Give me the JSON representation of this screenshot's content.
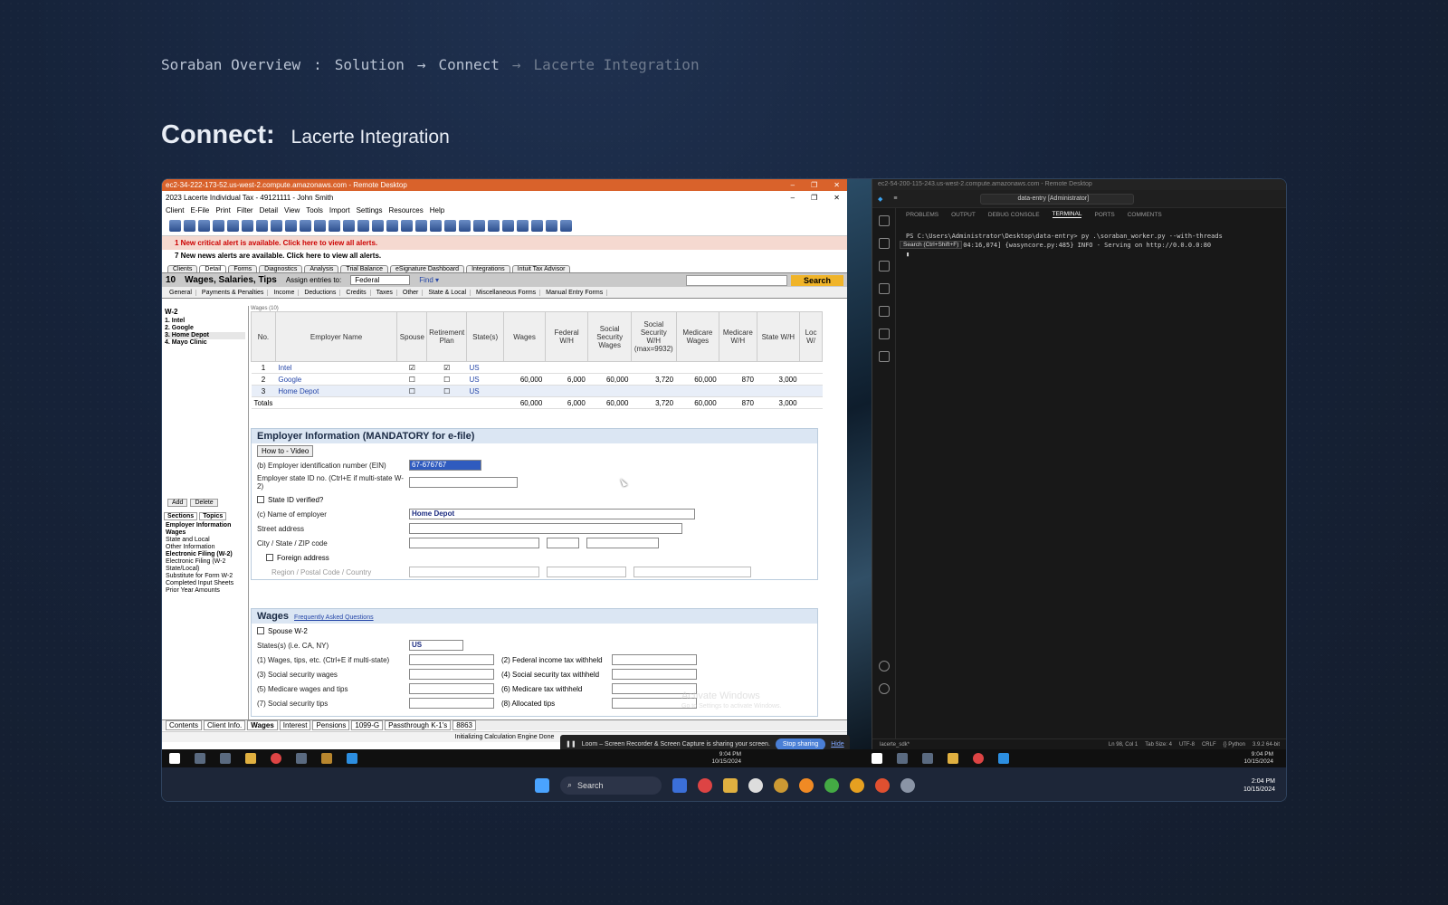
{
  "breadcrumb": {
    "items": [
      "Soraban Overview",
      ":",
      "Solution",
      "→",
      "Connect",
      "→",
      "Lacerte Integration"
    ]
  },
  "heading": {
    "main": "Connect:",
    "sub": "Lacerte Integration"
  },
  "left_window": {
    "rd_title": "ec2-34-222-173-52.us-west-2.compute.amazonaws.com - Remote Desktop",
    "app_title": "2023 Lacerte Individual Tax - 49121111 - John Smith",
    "menu": [
      "Client",
      "E-File",
      "Print",
      "Filter",
      "Detail",
      "View",
      "Tools",
      "Import",
      "Settings",
      "Resources",
      "Help"
    ],
    "alert": "1  New critical alert is available.  Click here to view all alerts.",
    "news": "7  New news alerts are available.  Click here to view all alerts.",
    "tabs": [
      "Clients",
      "Detail",
      "Forms",
      "Diagnostics",
      "Analysis",
      "Trial Balance",
      "eSignature Dashboard",
      "Integrations",
      "Intuit Tax Advisor"
    ],
    "section": {
      "num": "10",
      "name": "Wages, Salaries, Tips",
      "assign_label": "Assign entries to:",
      "assign_value": "Federal",
      "find": "Find ▾",
      "search_btn": "Search"
    },
    "sub_tabs": [
      "General",
      "Payments & Penalties",
      "Income",
      "Deductions",
      "Credits",
      "Taxes",
      "Other",
      "State & Local",
      "Miscellaneous Forms",
      "Manual Entry Forms"
    ],
    "sidebar": {
      "header": "W-2",
      "items": [
        "1. Intel",
        "2. Google",
        "3. Home Depot",
        "4. Mayo Clinic"
      ],
      "add": "Add",
      "delete": "Delete",
      "tabs": [
        "Sections",
        "Topics"
      ],
      "sections": [
        "Employer Information",
        "Wages",
        "State and Local",
        "Other Information",
        "Electronic Filing (W-2)",
        "Electronic Filing (W-2 State/Local)",
        "Substitute for Form W-2",
        "Completed Input Sheets",
        "Prior Year Amounts"
      ]
    },
    "grid": {
      "caption": "Wages (10)",
      "headers": [
        "No.",
        "Employer Name",
        "Spouse",
        "Retirement Plan",
        "State(s)",
        "Wages",
        "Federal W/H",
        "Social Security Wages",
        "Social Security W/H (max=9932)",
        "Medicare Wages",
        "Medicare W/H",
        "State W/H",
        "Loc W/"
      ],
      "rows": [
        [
          "1",
          "Intel",
          "☑",
          "☑",
          "US",
          "",
          "",
          "",
          "",
          "",
          "",
          "",
          ""
        ],
        [
          "2",
          "Google",
          "☐",
          "☐",
          "US",
          "60,000",
          "6,000",
          "60,000",
          "3,720",
          "60,000",
          "870",
          "3,000",
          ""
        ],
        [
          "3",
          "Home Depot",
          "☐",
          "☐",
          "US",
          "",
          "",
          "",
          "",
          "",
          "",
          "",
          ""
        ]
      ],
      "totals_label": "Totals",
      "totals": [
        "60,000",
        "6,000",
        "60,000",
        "3,720",
        "60,000",
        "870",
        "3,000"
      ]
    },
    "employer": {
      "header": "Employer Information (MANDATORY for e-file)",
      "video_btn": "How to - Video",
      "ein_label": "(b) Employer identification number (EIN)",
      "ein_value": "67-676767",
      "state_id_label": "Employer state ID no. (Ctrl+E  if multi-state W-2)",
      "state_verified": "State ID verified?",
      "name_label": "(c) Name of employer",
      "name_value": "Home Depot",
      "street_label": "Street address",
      "city_label": "City / State / ZIP code",
      "foreign_label": "Foreign address",
      "region_label": "Region / Postal Code / Country"
    },
    "wages": {
      "header": "Wages",
      "faq": "Frequently Asked Questions",
      "spouse": "Spouse W-2",
      "states_label": "States(s) (i.e. CA, NY)",
      "states_value": "US",
      "fields_left": [
        "(1) Wages, tips, etc. (Ctrl+E if multi-state)",
        "(3) Social security wages",
        "(5) Medicare wages and tips",
        "(7) Social security tips"
      ],
      "fields_right": [
        "(2) Federal income tax withheld",
        "(4) Social security tax withheld",
        "(6) Medicare tax withheld",
        "(8) Allocated tips"
      ]
    },
    "bottom_tabs": [
      "Contents",
      "Client Info.",
      "Wages",
      "Interest",
      "Pensions",
      "1099-G",
      "Passthrough K-1's",
      "8863"
    ],
    "status": "Initializing Calculation Engine Done"
  },
  "right_window": {
    "rd_title": "ec2-54-200-115-243.us-west-2.compute.amazonaws.com - Remote Desktop",
    "search_text": "data-entry [Administrator]",
    "panel_tabs": [
      "PROBLEMS",
      "OUTPUT",
      "DEBUG CONSOLE",
      "TERMINAL",
      "PORTS",
      "COMMENTS"
    ],
    "terminal_line1": "PS C:\\Users\\Administrator\\Desktop\\data-entry> py .\\soraban_worker.py --with-threads",
    "terminal_line2": "[2024-10-15 21:04:16,074] {wasyncore.py:485} INFO - Serving on http://0.0.0.0:80",
    "tooltip": "Search (Ctrl+Shift+F)",
    "status_left": "lacerte_sdk*",
    "status_right": [
      "Ln 98, Col 1",
      "Tab Size: 4",
      "UTF-8",
      "CRLF",
      "{} Python",
      "3.9.2 64-bit"
    ]
  },
  "loom": {
    "text": "Loom – Screen Recorder & Screen Capture is sharing your screen.",
    "stop": "Stop sharing",
    "hide": "Hide"
  },
  "activate": {
    "title": "Activate Windows",
    "sub": "Go to Settings to activate Windows."
  },
  "taskbar_inner": {
    "time": "9:04 PM",
    "date": "10/15/2024"
  },
  "taskbar_outer": {
    "search": "Search",
    "time": "2:04 PM",
    "date": "10/15/2024"
  }
}
